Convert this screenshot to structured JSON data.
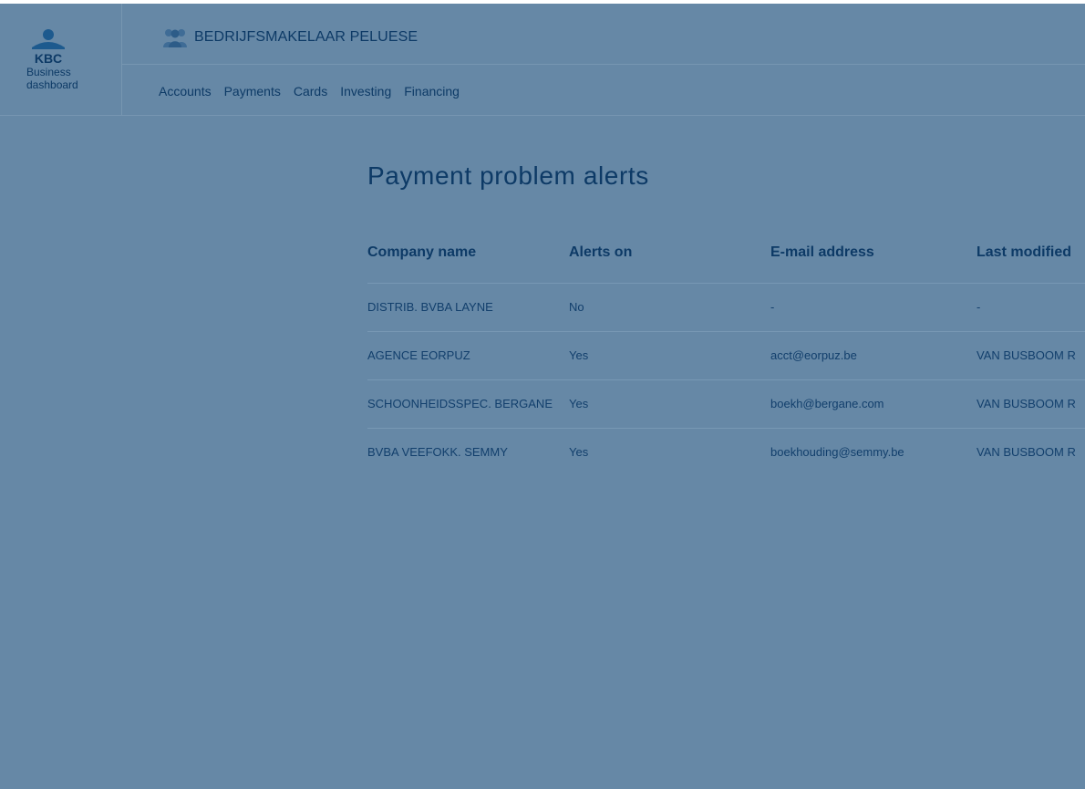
{
  "brand": {
    "logo_text": "KBC",
    "app_line1": "Business",
    "app_line2": "dashboard"
  },
  "header": {
    "company_name": "BEDRIJFSMAKELAAR PELUESE"
  },
  "nav": {
    "items": [
      {
        "label": "Accounts"
      },
      {
        "label": "Payments"
      },
      {
        "label": "Cards"
      },
      {
        "label": "Investing"
      },
      {
        "label": "Financing"
      }
    ]
  },
  "main": {
    "title": "Payment problem alerts",
    "table": {
      "headers": [
        "Company name",
        "Alerts on",
        "E-mail address",
        "Last modified"
      ],
      "rows": [
        [
          "DISTRIB. BVBA LAYNE",
          "No",
          "-",
          "-"
        ],
        [
          "AGENCE EORPUZ",
          "Yes",
          "acct@eorpuz.be",
          "VAN BUSBOOM R"
        ],
        [
          "SCHOONHEIDSSPEC. BERGANE",
          "Yes",
          "boekh@bergane.com",
          "VAN BUSBOOM R"
        ],
        [
          "BVBA VEEFOKK. SEMMY",
          "Yes",
          "boekhouding@semmy.be",
          "VAN BUSBOOM R"
        ]
      ]
    }
  },
  "colors": {
    "background": "#6688a6",
    "text_primary": "#0d3a66",
    "divider": "#7898b4"
  },
  "icons": {
    "logo": "kbc-logo-icon",
    "company": "users-group-icon"
  }
}
